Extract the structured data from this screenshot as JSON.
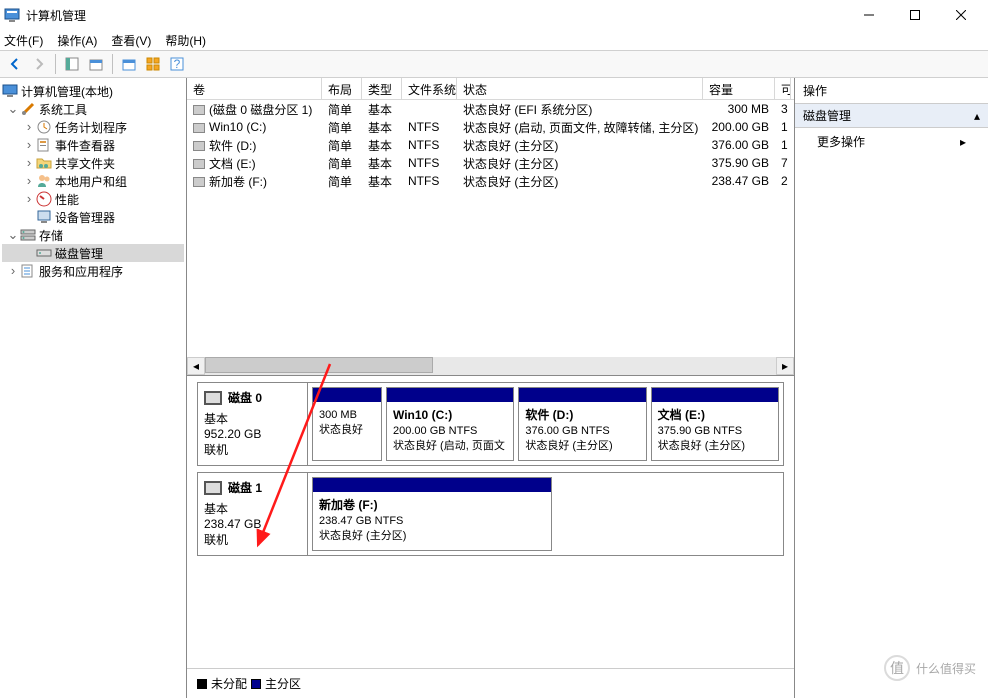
{
  "window": {
    "title": "计算机管理"
  },
  "menu": {
    "file": "文件(F)",
    "action": "操作(A)",
    "view": "查看(V)",
    "help": "帮助(H)"
  },
  "tree": {
    "root": "计算机管理(本地)",
    "systools": "系统工具",
    "tasksched": "任务计划程序",
    "eventvwr": "事件查看器",
    "sharedfolders": "共享文件夹",
    "localusers": "本地用户和组",
    "perf": "性能",
    "devmgr": "设备管理器",
    "storage": "存储",
    "diskmgmt": "磁盘管理",
    "services": "服务和应用程序"
  },
  "list": {
    "hdr": {
      "vol": "卷",
      "lay": "布局",
      "type": "类型",
      "fs": "文件系统",
      "stat": "状态",
      "cap": "容量",
      "free": "可"
    },
    "rows": [
      {
        "vol": "(磁盘 0 磁盘分区 1)",
        "lay": "简单",
        "type": "基本",
        "fs": "",
        "stat": "状态良好 (EFI 系统分区)",
        "cap": "300 MB",
        "free": "3"
      },
      {
        "vol": "Win10 (C:)",
        "lay": "简单",
        "type": "基本",
        "fs": "NTFS",
        "stat": "状态良好 (启动, 页面文件, 故障转储, 主分区)",
        "cap": "200.00 GB",
        "free": "1"
      },
      {
        "vol": "软件 (D:)",
        "lay": "简单",
        "type": "基本",
        "fs": "NTFS",
        "stat": "状态良好 (主分区)",
        "cap": "376.00 GB",
        "free": "1"
      },
      {
        "vol": "文档 (E:)",
        "lay": "简单",
        "type": "基本",
        "fs": "NTFS",
        "stat": "状态良好 (主分区)",
        "cap": "375.90 GB",
        "free": "7"
      },
      {
        "vol": "新加卷 (F:)",
        "lay": "简单",
        "type": "基本",
        "fs": "NTFS",
        "stat": "状态良好 (主分区)",
        "cap": "238.47 GB",
        "free": "2"
      }
    ]
  },
  "disks": [
    {
      "name": "磁盘 0",
      "type": "基本",
      "size": "952.20 GB",
      "status": "联机",
      "parts": [
        {
          "title": "",
          "line1": "300 MB",
          "line2": "状态良好"
        },
        {
          "title": "Win10  (C:)",
          "line1": "200.00 GB NTFS",
          "line2": "状态良好 (启动, 页面文"
        },
        {
          "title": "软件  (D:)",
          "line1": "376.00 GB NTFS",
          "line2": "状态良好 (主分区)"
        },
        {
          "title": "文档  (E:)",
          "line1": "375.90 GB NTFS",
          "line2": "状态良好 (主分区)"
        }
      ]
    },
    {
      "name": "磁盘 1",
      "type": "基本",
      "size": "238.47 GB",
      "status": "联机",
      "parts": [
        {
          "title": "新加卷  (F:)",
          "line1": "238.47 GB NTFS",
          "line2": "状态良好 (主分区)"
        }
      ]
    }
  ],
  "legend": {
    "unalloc": "未分配",
    "primary": "主分区"
  },
  "actions": {
    "hdr": "操作",
    "section": "磁盘管理",
    "more": "更多操作"
  },
  "watermark": {
    "text": "什么值得买",
    "sym": "值"
  }
}
